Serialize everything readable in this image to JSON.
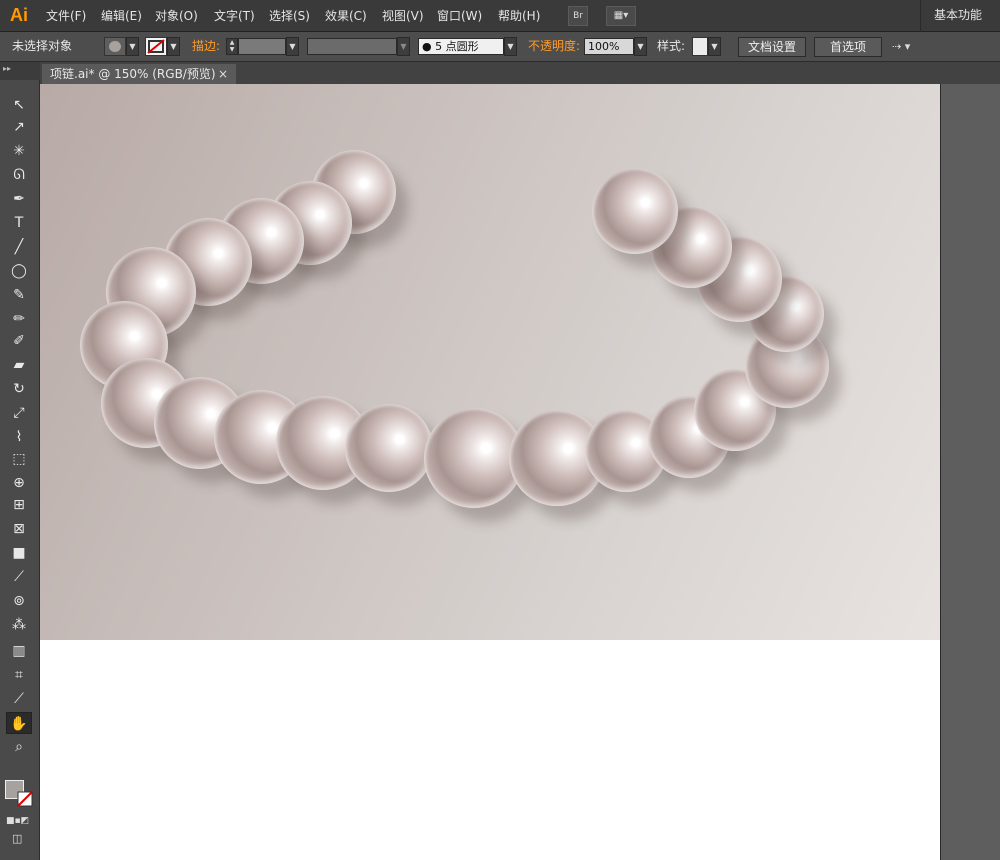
{
  "app": {
    "logo": "Ai",
    "workspace": "基本功能"
  },
  "menu": [
    "文件(F)",
    "编辑(E)",
    "对象(O)",
    "文字(T)",
    "选择(S)",
    "效果(C)",
    "视图(V)",
    "窗口(W)",
    "帮助(H)"
  ],
  "menubar_icons": {
    "bridge": "Br"
  },
  "control": {
    "selection": "未选择对象",
    "stroke_label": "描边:",
    "brush_value": "5 点圆形",
    "opacity_label": "不透明度:",
    "opacity_value": "100%",
    "style_label": "样式:",
    "doc_setup": "文档设置",
    "preferences": "首选项"
  },
  "document": {
    "tab_title": "项链.ai* @ 150% (RGB/预览)",
    "close": "×"
  },
  "tools": [
    {
      "name": "selection-tool",
      "glyph": "↖"
    },
    {
      "name": "direct-selection-tool",
      "glyph": "↗"
    },
    {
      "name": "magic-wand-tool",
      "glyph": "✳"
    },
    {
      "name": "lasso-tool",
      "glyph": "ᘏ"
    },
    {
      "name": "pen-tool",
      "glyph": "✒"
    },
    {
      "name": "type-tool",
      "glyph": "T"
    },
    {
      "name": "line-tool",
      "glyph": "╱"
    },
    {
      "name": "ellipse-tool",
      "glyph": "◯"
    },
    {
      "name": "paintbrush-tool",
      "glyph": "✎"
    },
    {
      "name": "pencil-tool",
      "glyph": "✏"
    },
    {
      "name": "blob-brush-tool",
      "glyph": "✐"
    },
    {
      "name": "eraser-tool",
      "glyph": "▰"
    },
    {
      "name": "rotate-tool",
      "glyph": "↻"
    },
    {
      "name": "scale-tool",
      "glyph": "⤢"
    },
    {
      "name": "width-tool",
      "glyph": "⌇"
    },
    {
      "name": "free-transform-tool",
      "glyph": "⬚"
    },
    {
      "name": "shape-builder-tool",
      "glyph": "⊕"
    },
    {
      "name": "perspective-grid-tool",
      "glyph": "⊞"
    },
    {
      "name": "mesh-tool",
      "glyph": "⊠"
    },
    {
      "name": "gradient-tool",
      "glyph": "■"
    },
    {
      "name": "eyedropper-tool",
      "glyph": "⟋"
    },
    {
      "name": "blend-tool",
      "glyph": "⊚"
    },
    {
      "name": "symbol-sprayer-tool",
      "glyph": "⁂"
    },
    {
      "name": "column-graph-tool",
      "glyph": "▥"
    },
    {
      "name": "artboard-tool",
      "glyph": "⌗"
    },
    {
      "name": "slice-tool",
      "glyph": "⟋"
    },
    {
      "name": "hand-tool",
      "glyph": "✋"
    },
    {
      "name": "zoom-tool",
      "glyph": "⌕"
    }
  ],
  "colors": {
    "accent_orange": "#ff9c2b",
    "ai_logo": "#ff9a00",
    "artboard_light": "#e8e3e0",
    "artboard_dark": "#b8aaa6"
  }
}
